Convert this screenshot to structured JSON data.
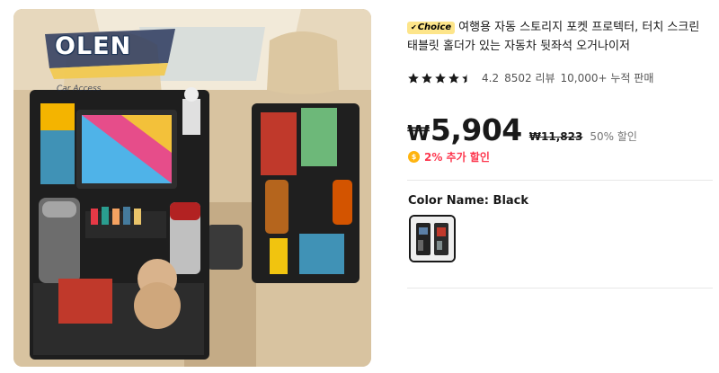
{
  "product_image": {
    "brand_text": "OLEN",
    "brand_sub": "Car Access",
    "alt": "car seat back organizer"
  },
  "product": {
    "badge": "Choice",
    "title": "여행용 자동 스토리지 포켓 프로텍터, 터치 스크린 태블릿 홀더가 있는 자동차 뒷좌석 오거나이저",
    "rating": "4.2",
    "rating_value": 4.2,
    "reviews": "8502 리뷰",
    "sold": "10,000+ 누적 판매",
    "currency": "₩",
    "price": "5,904",
    "original_price": "₩11,823",
    "discount": "50% 할인",
    "extra_discount": "2% 추가 할인",
    "color_label": "Color Name: Black",
    "color_options": [
      "Black"
    ]
  },
  "colors": {
    "star": "#191919",
    "accent_red": "#fd384f",
    "choice_bg": "#fde58a",
    "coin": "#ffb40f"
  },
  "icons": [
    "star-icon",
    "coin-icon",
    "check-icon"
  ]
}
